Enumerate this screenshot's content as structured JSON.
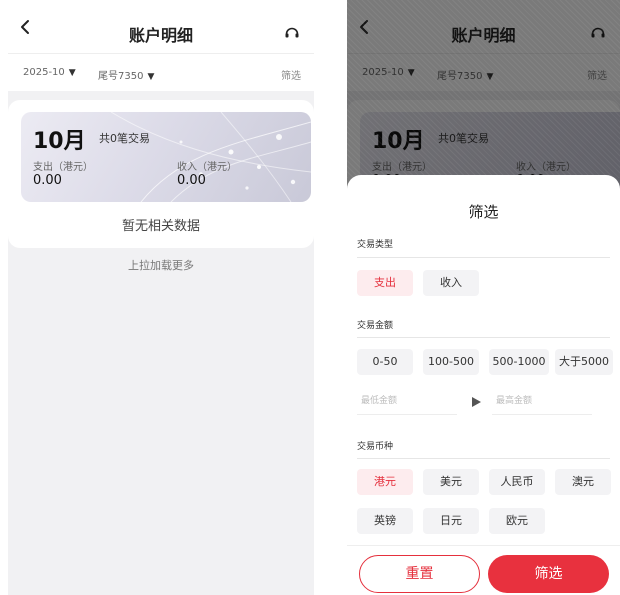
{
  "header": {
    "title": "账户明细"
  },
  "filterbar": {
    "month": "2025-10",
    "card": "尾号7350",
    "filter_link": "筛选",
    "caret": "▼"
  },
  "summary": {
    "month": "10月",
    "count": "共0笔交易",
    "expense_label": "支出（港元）",
    "expense_value": "0.00",
    "income_label": "收入（港元）",
    "income_value": "0.00"
  },
  "empty_text": "暂无相关数据",
  "load_more": "上拉加载更多",
  "sheet": {
    "title": "筛选",
    "type_section": {
      "title": "交易类型",
      "options": [
        "支出",
        "收入"
      ],
      "selected": "支出"
    },
    "amount_section": {
      "title": "交易金额",
      "options": [
        "0-50",
        "100-500",
        "500-1000",
        "大于5000"
      ],
      "min_placeholder": "最低金额",
      "max_placeholder": "最高金额"
    },
    "currency_section": {
      "title": "交易币种",
      "options": [
        "港元",
        "美元",
        "人民币",
        "澳元",
        "英镑",
        "日元",
        "欧元"
      ],
      "selected": "港元"
    },
    "reset_label": "重置",
    "filter_label": "筛选"
  },
  "colors": {
    "accent": "#e5303d",
    "chip_bg": "#f3f3f5",
    "active_chip_bg": "#fdecee"
  }
}
